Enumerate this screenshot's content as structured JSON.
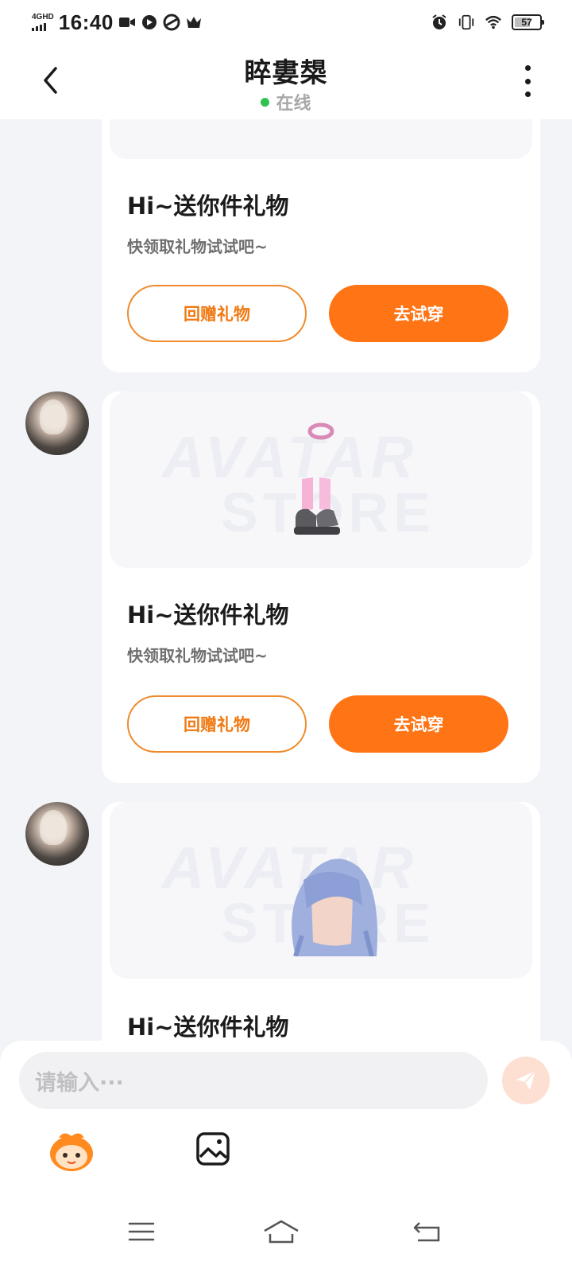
{
  "status_bar": {
    "network": "4GHD",
    "time": "16:40",
    "battery": "57"
  },
  "header": {
    "title": "睟婁槼",
    "status": "在线"
  },
  "messages": [
    {
      "title": "Hi~送你件礼物",
      "subtitle": "快领取礼物试试吧~",
      "return_gift_label": "回赠礼物",
      "try_on_label": "去试穿"
    },
    {
      "title": "Hi~送你件礼物",
      "subtitle": "快领取礼物试试吧~",
      "return_gift_label": "回赠礼物",
      "try_on_label": "去试穿",
      "watermark_line1": "AVATAR",
      "watermark_line2": "STORE"
    },
    {
      "title": "Hi~送你件礼物",
      "watermark_line1": "AVATAR",
      "watermark_line2": "STORE"
    }
  ],
  "input": {
    "placeholder": "请输入···"
  },
  "colors": {
    "accent": "#ff7414",
    "online": "#2fc24f",
    "background": "#f3f4f8"
  },
  "icons": {
    "back": "chevron-left-icon",
    "more": "more-vertical-icon",
    "send": "send-icon",
    "emoji": "mascot-emoji-icon",
    "image": "image-icon"
  }
}
